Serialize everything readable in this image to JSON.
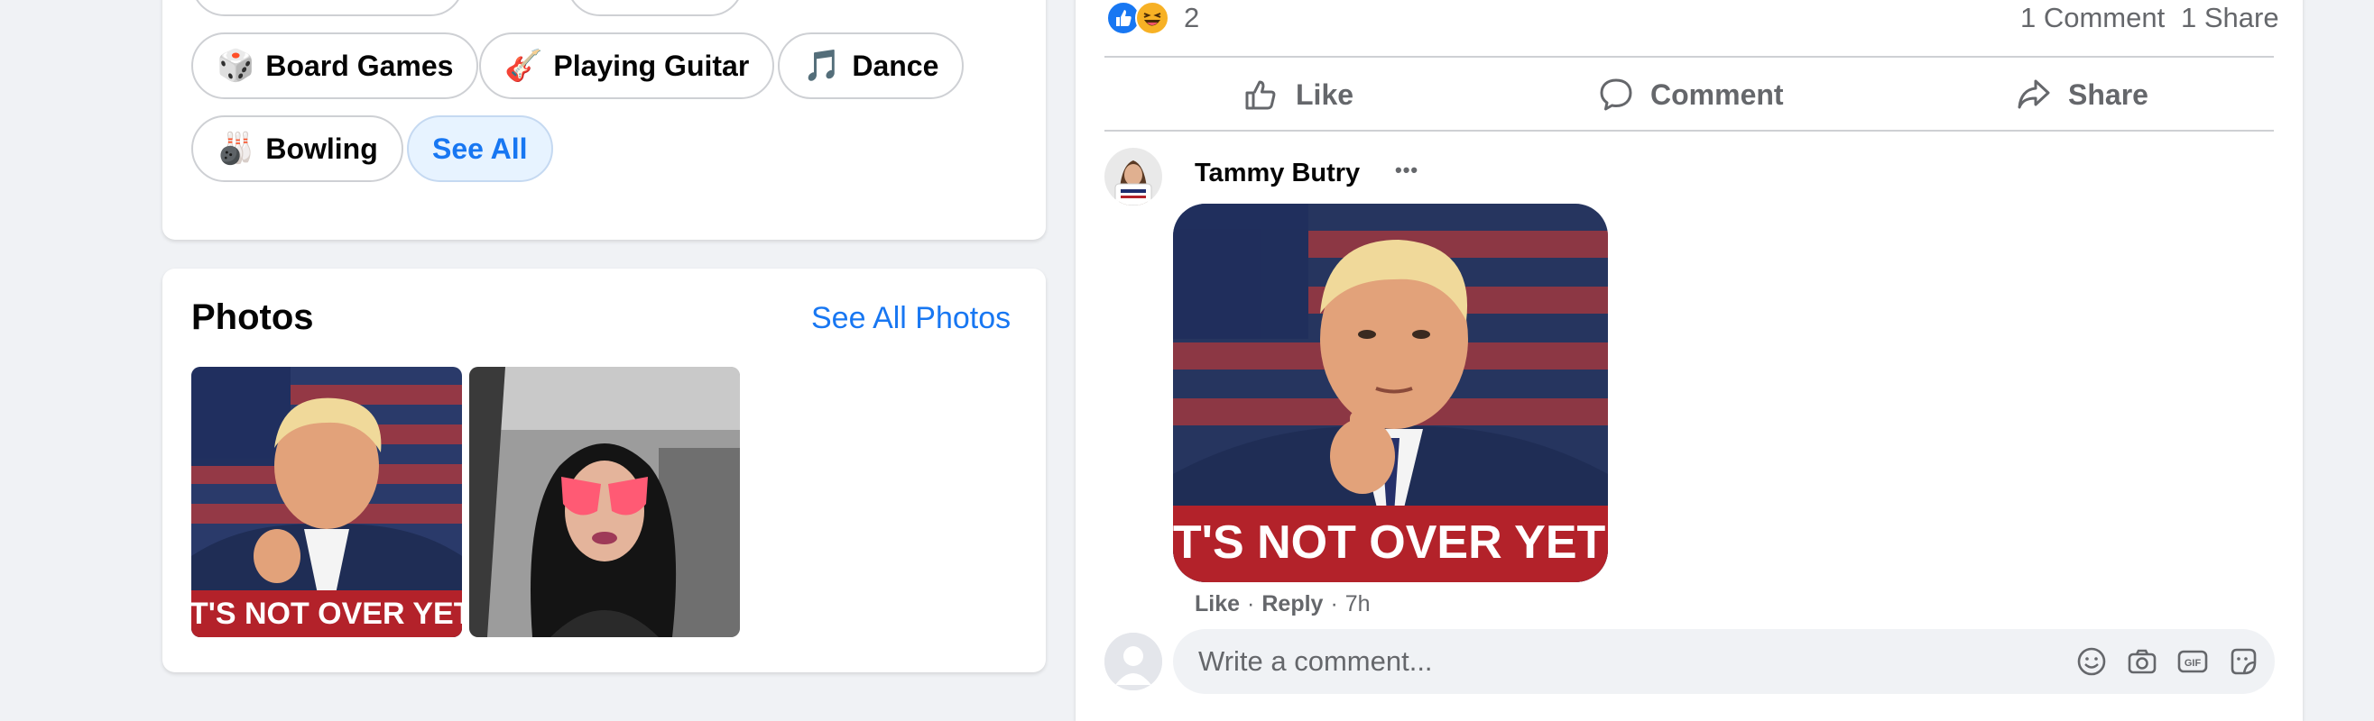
{
  "intro": {
    "hobbies": [
      {
        "emoji": "🎲",
        "label": "Board Games"
      },
      {
        "emoji": "🎸",
        "label": "Playing Guitar"
      },
      {
        "emoji": "🎵",
        "label": "Dance"
      },
      {
        "emoji": "🎳",
        "label": "Bowling"
      }
    ],
    "see_all_label": "See All"
  },
  "photos": {
    "title": "Photos",
    "see_all_label": "See All Photos",
    "thumb_banner_text": "IT'S NOT OVER YET"
  },
  "post": {
    "reaction_count": "2",
    "comment_count": "1 Comment",
    "share_count": "1 Share",
    "actions": {
      "like": "Like",
      "comment": "Comment",
      "share": "Share"
    }
  },
  "comment": {
    "author": "Tammy Butry",
    "more_label": "•••",
    "image_banner_text": "IT'S NOT OVER YET!",
    "like_label": "Like",
    "reply_label": "Reply",
    "time": "7h",
    "sep": "·"
  },
  "composer": {
    "placeholder": "Write a comment..."
  },
  "colors": {
    "accent": "#1877f2",
    "background": "#f0f2f5",
    "secondary_text": "#65676b",
    "banner_red": "#b3222a"
  },
  "icons": [
    "like-reaction-icon",
    "haha-reaction-icon",
    "thumbs-up-icon",
    "comment-icon",
    "share-icon",
    "more-options-icon",
    "emoji-icon",
    "camera-icon",
    "gif-icon",
    "sticker-icon",
    "avatar-placeholder-icon"
  ]
}
